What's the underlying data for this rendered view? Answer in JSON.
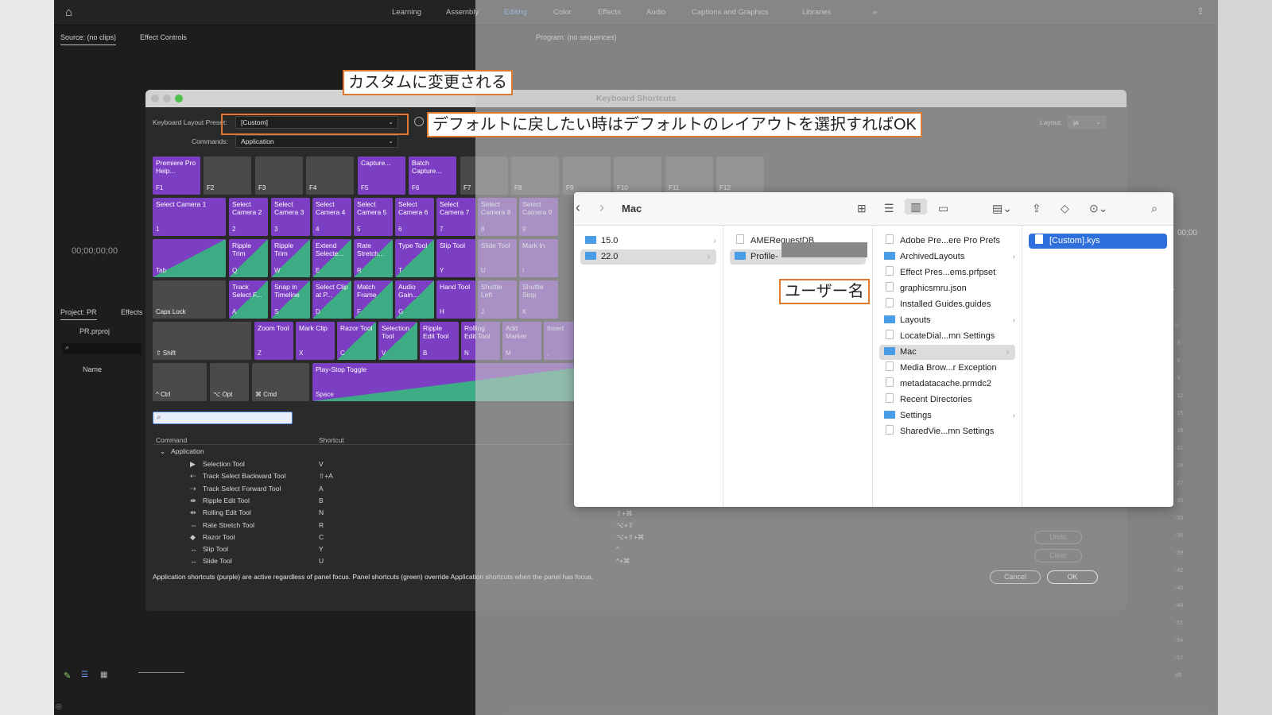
{
  "topbar": {
    "workspaces": [
      "Learning",
      "Assembly",
      "Editing",
      "Color",
      "Effects",
      "Audio",
      "Captions and Graphics",
      "Libraries"
    ],
    "active": "Editing",
    "more": "»"
  },
  "source_panel": {
    "tab1": "Source: (no clips)",
    "tab2": "Effect Controls",
    "timecode": "00;00;00;00"
  },
  "program_panel": {
    "tab": "Program: (no sequences)",
    "timecode": "00;00"
  },
  "project_panel": {
    "tab1": "Project: PR",
    "tab2": "Effects",
    "file": "PR.prproj",
    "col_name": "Name"
  },
  "dialog": {
    "title": "Keyboard Shortcuts",
    "preset_label": "Keyboard Layout Preset:",
    "preset_value": "[Custom]",
    "commands_label": "Commands:",
    "commands_value": "Application",
    "layout_label": "Layout:",
    "layout_value": "ja",
    "rows": [
      [
        {
          "t": "Premiere Pro Help...",
          "k": "F1",
          "c": "purple"
        },
        {
          "t": "",
          "k": "F2",
          "c": "gray"
        },
        {
          "t": "",
          "k": "F3",
          "c": "gray"
        },
        {
          "t": "",
          "k": "F4",
          "c": "gray"
        },
        {
          "t": "Capture...",
          "k": "F5",
          "c": "purple"
        },
        {
          "t": "Batch Capture...",
          "k": "F6",
          "c": "purple"
        },
        {
          "t": "",
          "k": "F7",
          "c": "gray"
        },
        {
          "t": "",
          "k": "F8",
          "c": "gray"
        },
        {
          "t": "",
          "k": "F9",
          "c": "gray"
        },
        {
          "t": "",
          "k": "F10",
          "c": "gray"
        },
        {
          "t": "",
          "k": "F11",
          "c": "gray"
        },
        {
          "t": "",
          "k": "F12",
          "c": "gray"
        }
      ],
      [
        {
          "t": "Select Camera 1",
          "k": "1",
          "c": "purple"
        },
        {
          "t": "Select Camera 2",
          "k": "2",
          "c": "purple"
        },
        {
          "t": "Select Camera 3",
          "k": "3",
          "c": "purple"
        },
        {
          "t": "Select Camera 4",
          "k": "4",
          "c": "purple"
        },
        {
          "t": "Select Camera 5",
          "k": "5",
          "c": "purple"
        },
        {
          "t": "Select Camera 6",
          "k": "6",
          "c": "purple"
        },
        {
          "t": "Select Camera 7",
          "k": "7",
          "c": "purple"
        },
        {
          "t": "Select Camera 8",
          "k": "8",
          "c": "purple"
        },
        {
          "t": "Select Camera 9",
          "k": "9",
          "c": "purple"
        }
      ],
      [
        {
          "t": "",
          "k": "Tab",
          "c": "gray green"
        },
        {
          "t": "Ripple Trim",
          "k": "Q",
          "c": "green"
        },
        {
          "t": "Ripple Trim",
          "k": "W",
          "c": "green"
        },
        {
          "t": "Extend Selecte...",
          "k": "E",
          "c": "green"
        },
        {
          "t": "Rate Stretch...",
          "k": "R",
          "c": "green"
        },
        {
          "t": "Type Tool",
          "k": "T",
          "c": "green"
        },
        {
          "t": "Slip Tool",
          "k": "Y",
          "c": "purple"
        },
        {
          "t": "Slide Tool",
          "k": "U",
          "c": "purple"
        },
        {
          "t": "Mark In",
          "k": "I",
          "c": "purple"
        }
      ],
      [
        {
          "t": "",
          "k": "Caps Lock",
          "c": "gray"
        },
        {
          "t": "Track Select F...",
          "k": "A",
          "c": "green"
        },
        {
          "t": "Snap in Timeline",
          "k": "S",
          "c": "green"
        },
        {
          "t": "Select Clip at P...",
          "k": "D",
          "c": "green"
        },
        {
          "t": "Match Frame",
          "k": "F",
          "c": "green"
        },
        {
          "t": "Audio Gain...",
          "k": "G",
          "c": "green"
        },
        {
          "t": "Hand Tool",
          "k": "H",
          "c": "purple"
        },
        {
          "t": "Shuttle Left",
          "k": "J",
          "c": "purple"
        },
        {
          "t": "Shuttle Stop",
          "k": "K",
          "c": "purple"
        }
      ],
      [
        {
          "t": "",
          "k": "⇧ Shift",
          "c": "gray"
        },
        {
          "t": "Zoom Tool",
          "k": "Z",
          "c": "purple"
        },
        {
          "t": "Mark Clip",
          "k": "X",
          "c": "purple"
        },
        {
          "t": "Razor Tool",
          "k": "C",
          "c": "green"
        },
        {
          "t": "Selection Tool",
          "k": "V",
          "c": "green"
        },
        {
          "t": "Ripple Edit Tool",
          "k": "B",
          "c": "purple"
        },
        {
          "t": "Rolling Edit Tool",
          "k": "N",
          "c": "purple"
        },
        {
          "t": "Add Marker",
          "k": "M",
          "c": "purple"
        },
        {
          "t": "Insert",
          "k": ",",
          "c": "purple"
        }
      ],
      [
        {
          "t": "",
          "k": "^ Ctrl",
          "c": "gray"
        },
        {
          "t": "",
          "k": "⌥ Opt",
          "c": "gray"
        },
        {
          "t": "",
          "k": "⌘ Cmd",
          "c": "gray"
        },
        {
          "t": "Play-Stop Toggle",
          "k": "Space",
          "c": "green"
        }
      ]
    ],
    "col_command": "Command",
    "col_shortcut": "Shortcut",
    "group": "Application",
    "commands": [
      {
        "name": "Selection Tool",
        "shortcut": "V",
        "icon": "▶"
      },
      {
        "name": "Track Select Backward Tool",
        "shortcut": "⇧+A",
        "icon": "⇠"
      },
      {
        "name": "Track Select Forward Tool",
        "shortcut": "A",
        "icon": "⇢"
      },
      {
        "name": "Ripple Edit Tool",
        "shortcut": "B",
        "icon": "⇼"
      },
      {
        "name": "Rolling Edit Tool",
        "shortcut": "N",
        "icon": "⇹"
      },
      {
        "name": "Rate Stretch Tool",
        "shortcut": "R",
        "icon": "⇔"
      },
      {
        "name": "Razor Tool",
        "shortcut": "C",
        "icon": "◆"
      },
      {
        "name": "Slip Tool",
        "shortcut": "Y",
        "icon": "↔"
      },
      {
        "name": "Slide Tool",
        "shortcut": "U",
        "icon": "↔"
      }
    ],
    "right_shortcuts": [
      "⌥+⌘",
      "⇧+⌘",
      "⌥+⇧",
      "⌥+⇧+⌘",
      "^",
      "^+⌘"
    ],
    "undo": "Undo",
    "clear": "Clear",
    "note": "Application shortcuts (purple) are active regardless of panel focus. Panel shortcuts (green) override Application shortcuts when the panel has focus.",
    "cancel": "Cancel",
    "ok": "OK"
  },
  "finder": {
    "title": "Mac",
    "col1": [
      {
        "name": "15.0",
        "type": "folder",
        "arrow": true
      },
      {
        "name": "22.0",
        "type": "folder",
        "arrow": true,
        "hl": true
      }
    ],
    "col2": [
      {
        "name": "AMERequestDB",
        "type": "doc"
      },
      {
        "name": "Profile-",
        "type": "folder",
        "hl": true
      }
    ],
    "col3": [
      {
        "name": "Adobe Pre...ere Pro Prefs",
        "type": "doc"
      },
      {
        "name": "ArchivedLayouts",
        "type": "folder",
        "arrow": true
      },
      {
        "name": "Effect Pres...ems.prfpset",
        "type": "doc"
      },
      {
        "name": "graphicsmru.json",
        "type": "doc"
      },
      {
        "name": "Installed Guides.guides",
        "type": "doc"
      },
      {
        "name": "Layouts",
        "type": "folder",
        "arrow": true
      },
      {
        "name": "LocateDial...mn Settings",
        "type": "doc"
      },
      {
        "name": "Mac",
        "type": "folder",
        "arrow": true,
        "hl": true
      },
      {
        "name": "Media Brow...r Exception",
        "type": "doc"
      },
      {
        "name": "metadatacache.prmdc2",
        "type": "doc"
      },
      {
        "name": "Recent Directories",
        "type": "doc"
      },
      {
        "name": "Settings",
        "type": "folder",
        "arrow": true
      },
      {
        "name": "SharedVie...mn Settings",
        "type": "doc"
      }
    ],
    "col4": [
      {
        "name": "[Custom].kys",
        "type": "doc",
        "blue": true
      }
    ]
  },
  "callouts": {
    "custom": "カスタムに変更される",
    "default": "デフォルトに戻したい時はデフォルトのレイアウトを選択すればOK",
    "username": "ユーザー名"
  },
  "meter_ticks": [
    "0",
    "-3",
    "-6",
    "-9",
    "-12",
    "-15",
    "-18",
    "-21",
    "-24",
    "-27",
    "-30",
    "-33",
    "-36",
    "-39",
    "-42",
    "-45",
    "-48",
    "-51",
    "-54",
    "-57",
    "dB"
  ]
}
